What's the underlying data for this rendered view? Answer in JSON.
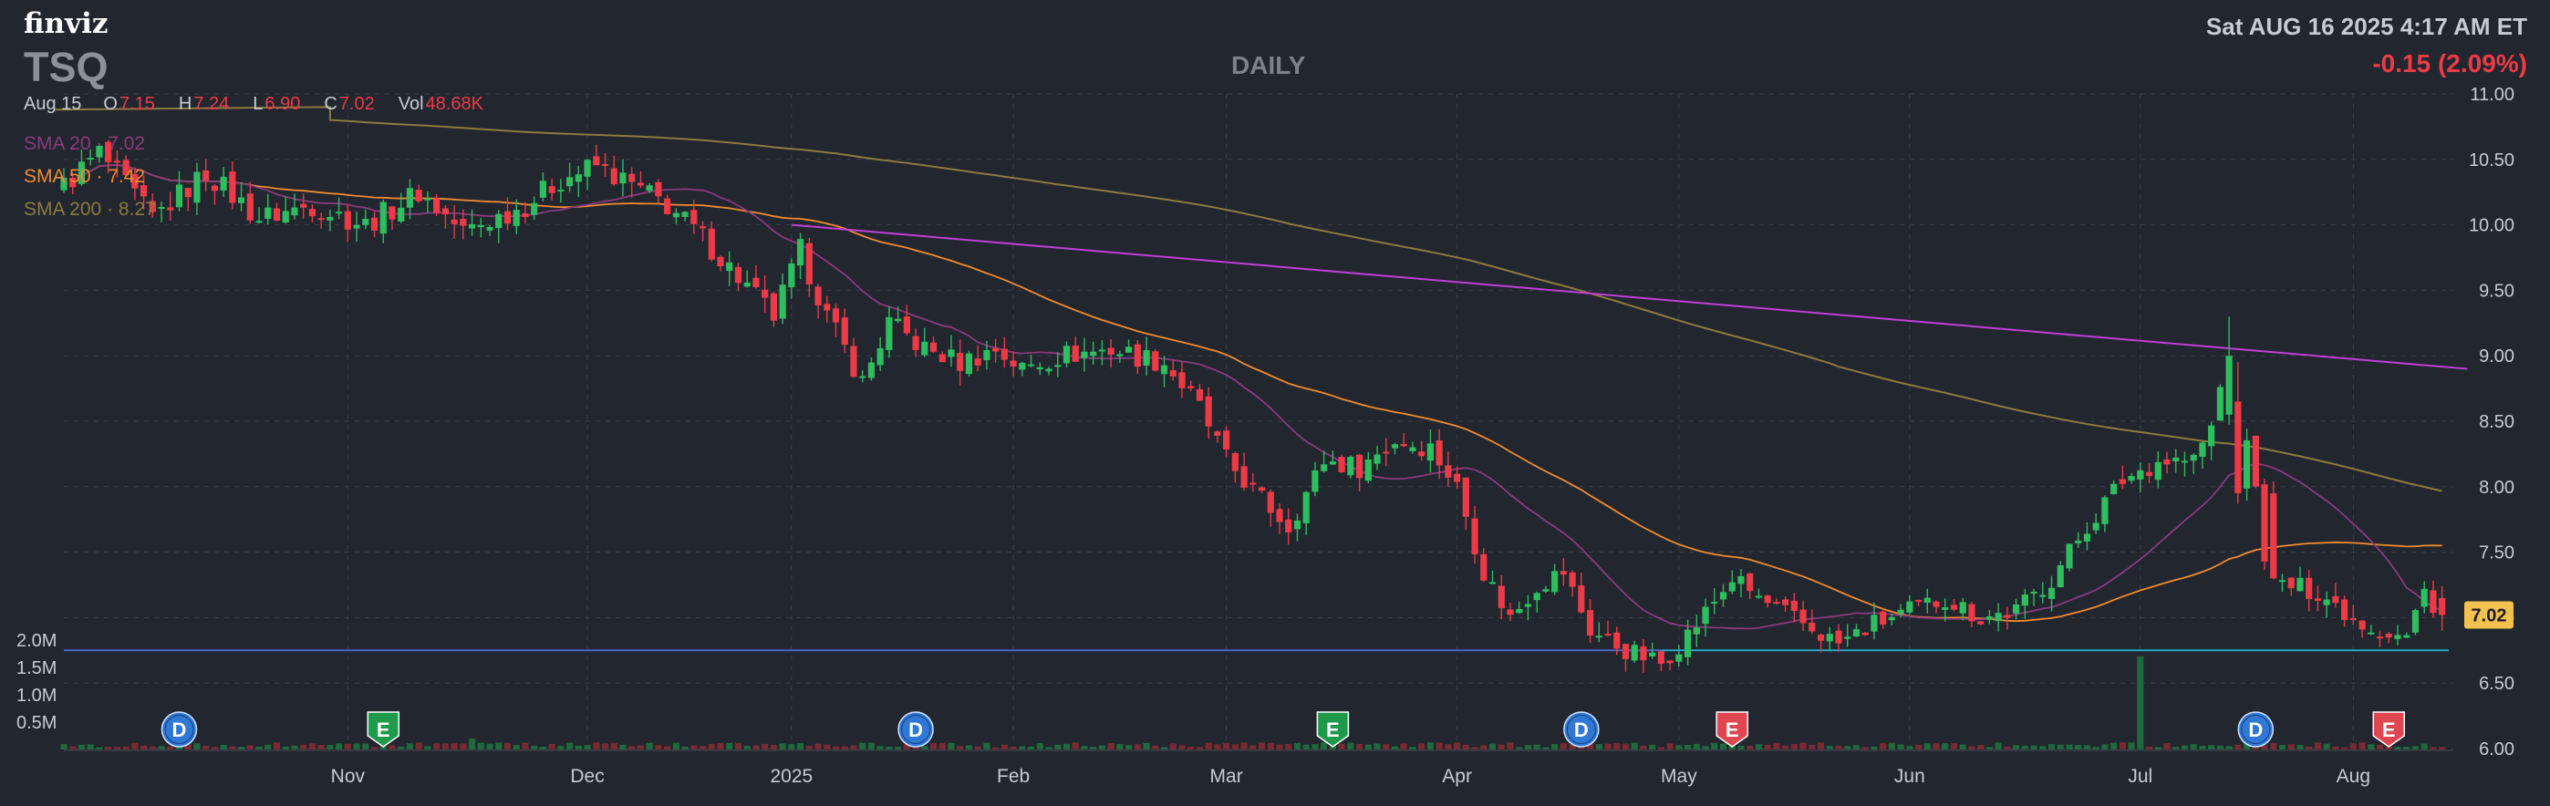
{
  "header": {
    "logo": "finviz",
    "ticker": "TSQ",
    "timeframe": "DAILY",
    "datetime": "Sat AUG 16 2025 4:17 AM ET",
    "change": "-0.15 (2.09%)",
    "date_label": "Aug 15",
    "ohlcv": [
      {
        "label": "O",
        "value": "7.15"
      },
      {
        "label": "H",
        "value": "7.24"
      },
      {
        "label": "L",
        "value": "6.90"
      },
      {
        "label": "C",
        "value": "7.02"
      },
      {
        "label": "Vol",
        "value": "48.68K"
      }
    ]
  },
  "legend": [
    {
      "name": "SMA 20",
      "value": "7.02",
      "color": "#8a3a7c"
    },
    {
      "name": "SMA 50",
      "value": "7.42",
      "color": "#f08b2f"
    },
    {
      "name": "SMA 200",
      "value": "8.27",
      "color": "#8c7a3e"
    }
  ],
  "price_tag": "7.02",
  "colors": {
    "up": "#2ebd5f",
    "down": "#eb3b46",
    "grid": "#3a3f4b",
    "text": "#c7cbd3",
    "trendline": "#c03fd6",
    "support": "#4c63c9",
    "support_right": "#28a6c8"
  },
  "chart_data": {
    "type": "candlestick",
    "title": "",
    "ylim": [
      6.0,
      11.0
    ],
    "y_ticks": [
      "11.00",
      "10.50",
      "10.00",
      "9.50",
      "9.00",
      "8.50",
      "8.00",
      "7.50",
      "7.00",
      "6.50",
      "6.00"
    ],
    "volume_ticks": [
      "2.0M",
      "1.5M",
      "1.0M",
      "0.5M"
    ],
    "volume_max": 2.0,
    "x_labels": [
      {
        "label": "Nov",
        "bar": 32
      },
      {
        "label": "Dec",
        "bar": 59
      },
      {
        "label": "2025",
        "bar": 82
      },
      {
        "label": "Feb",
        "bar": 107
      },
      {
        "label": "Mar",
        "bar": 131
      },
      {
        "label": "Apr",
        "bar": 157
      },
      {
        "label": "May",
        "bar": 182
      },
      {
        "label": "Jun",
        "bar": 208
      },
      {
        "label": "Jul",
        "bar": 234
      },
      {
        "label": "Aug",
        "bar": 258
      }
    ],
    "events": [
      {
        "type": "D",
        "bar": 13
      },
      {
        "type": "E",
        "bar": 36
      },
      {
        "type": "D",
        "bar": 96
      },
      {
        "type": "E",
        "bar": 143
      },
      {
        "type": "D",
        "bar": 171
      },
      {
        "type": "E",
        "bar": 188
      },
      {
        "type": "D",
        "bar": 247
      },
      {
        "type": "E",
        "bar": 262
      }
    ],
    "anchors": [
      [
        0,
        10.3
      ],
      [
        4,
        10.55
      ],
      [
        10,
        10.05
      ],
      [
        16,
        10.4
      ],
      [
        22,
        10.05
      ],
      [
        28,
        10.15
      ],
      [
        34,
        10.0
      ],
      [
        40,
        10.25
      ],
      [
        45,
        9.95
      ],
      [
        52,
        10.15
      ],
      [
        56,
        10.35
      ],
      [
        60,
        10.45
      ],
      [
        64,
        10.3
      ],
      [
        68,
        10.15
      ],
      [
        72,
        9.9
      ],
      [
        76,
        9.6
      ],
      [
        80,
        9.3
      ],
      [
        83,
        9.8
      ],
      [
        86,
        9.3
      ],
      [
        90,
        8.8
      ],
      [
        93,
        9.25
      ],
      [
        97,
        9.05
      ],
      [
        101,
        8.95
      ],
      [
        105,
        9.05
      ],
      [
        108,
        8.9
      ],
      [
        112,
        9.0
      ],
      [
        118,
        9.05
      ],
      [
        124,
        8.95
      ],
      [
        128,
        8.6
      ],
      [
        131,
        8.2
      ],
      [
        135,
        7.9
      ],
      [
        138,
        7.7
      ],
      [
        142,
        8.2
      ],
      [
        146,
        8.15
      ],
      [
        150,
        8.35
      ],
      [
        154,
        8.3
      ],
      [
        157,
        8.0
      ],
      [
        160,
        7.35
      ],
      [
        163,
        7.0
      ],
      [
        166,
        7.25
      ],
      [
        169,
        7.35
      ],
      [
        172,
        6.9
      ],
      [
        176,
        6.75
      ],
      [
        180,
        6.65
      ],
      [
        184,
        6.95
      ],
      [
        188,
        7.3
      ],
      [
        192,
        7.1
      ],
      [
        196,
        6.95
      ],
      [
        200,
        6.8
      ],
      [
        204,
        6.95
      ],
      [
        208,
        7.05
      ],
      [
        212,
        7.15
      ],
      [
        216,
        7.0
      ],
      [
        220,
        7.05
      ],
      [
        224,
        7.3
      ],
      [
        228,
        7.7
      ],
      [
        232,
        8.05
      ],
      [
        236,
        8.2
      ],
      [
        240,
        8.2
      ],
      [
        242,
        8.45
      ],
      [
        244,
        9.05
      ],
      [
        246,
        8.4
      ],
      [
        248,
        7.5
      ],
      [
        250,
        7.25
      ],
      [
        254,
        7.2
      ],
      [
        258,
        7.0
      ],
      [
        261,
        6.9
      ],
      [
        264,
        6.85
      ],
      [
        266,
        7.2
      ],
      [
        268,
        7.02
      ]
    ],
    "volume_spikes": [
      {
        "bar": 234,
        "value": 1.7
      },
      {
        "bar": 46,
        "value": 0.2
      }
    ],
    "trendline": [
      {
        "bar": 82,
        "value": 10.0
      },
      {
        "bar": 276,
        "value": 8.9
      }
    ],
    "support": {
      "value": 6.75,
      "right_from_bar": 180
    },
    "sma": [
      "SMA 20",
      "SMA 50",
      "SMA 200"
    ]
  }
}
